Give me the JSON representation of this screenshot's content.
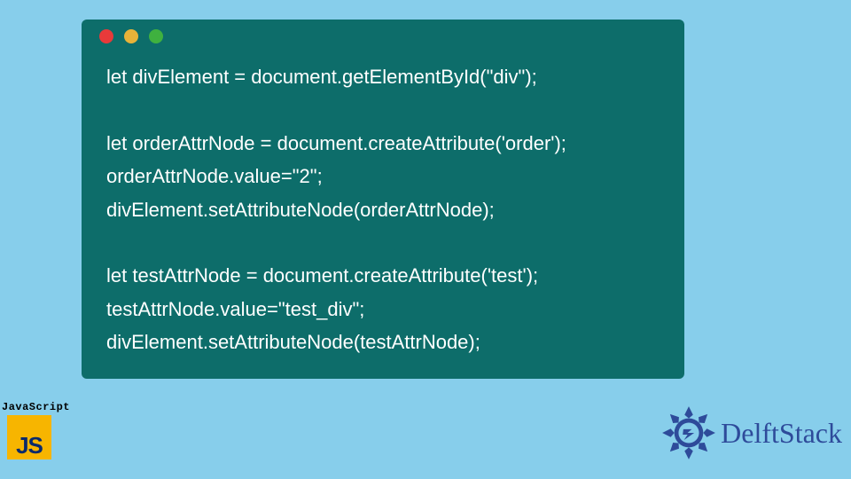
{
  "code": {
    "lines": [
      "let divElement = document.getElementById(\"div\");",
      "",
      "let orderAttrNode = document.createAttribute('order');",
      "orderAttrNode.value=\"2\";",
      "divElement.setAttributeNode(orderAttrNode);",
      "",
      "let testAttrNode = document.createAttribute('test');",
      "testAttrNode.value=\"test_div\";",
      "divElement.setAttributeNode(testAttrNode);"
    ]
  },
  "js_badge": {
    "label": "JavaScript",
    "mark": "JS"
  },
  "brand": {
    "name": "DelftStack"
  },
  "colors": {
    "bg": "#87ceeb",
    "window": "#0d6d6a",
    "js_bg": "#f7b500",
    "js_fg": "#0a2a6b",
    "brand": "#2e4b9a"
  }
}
